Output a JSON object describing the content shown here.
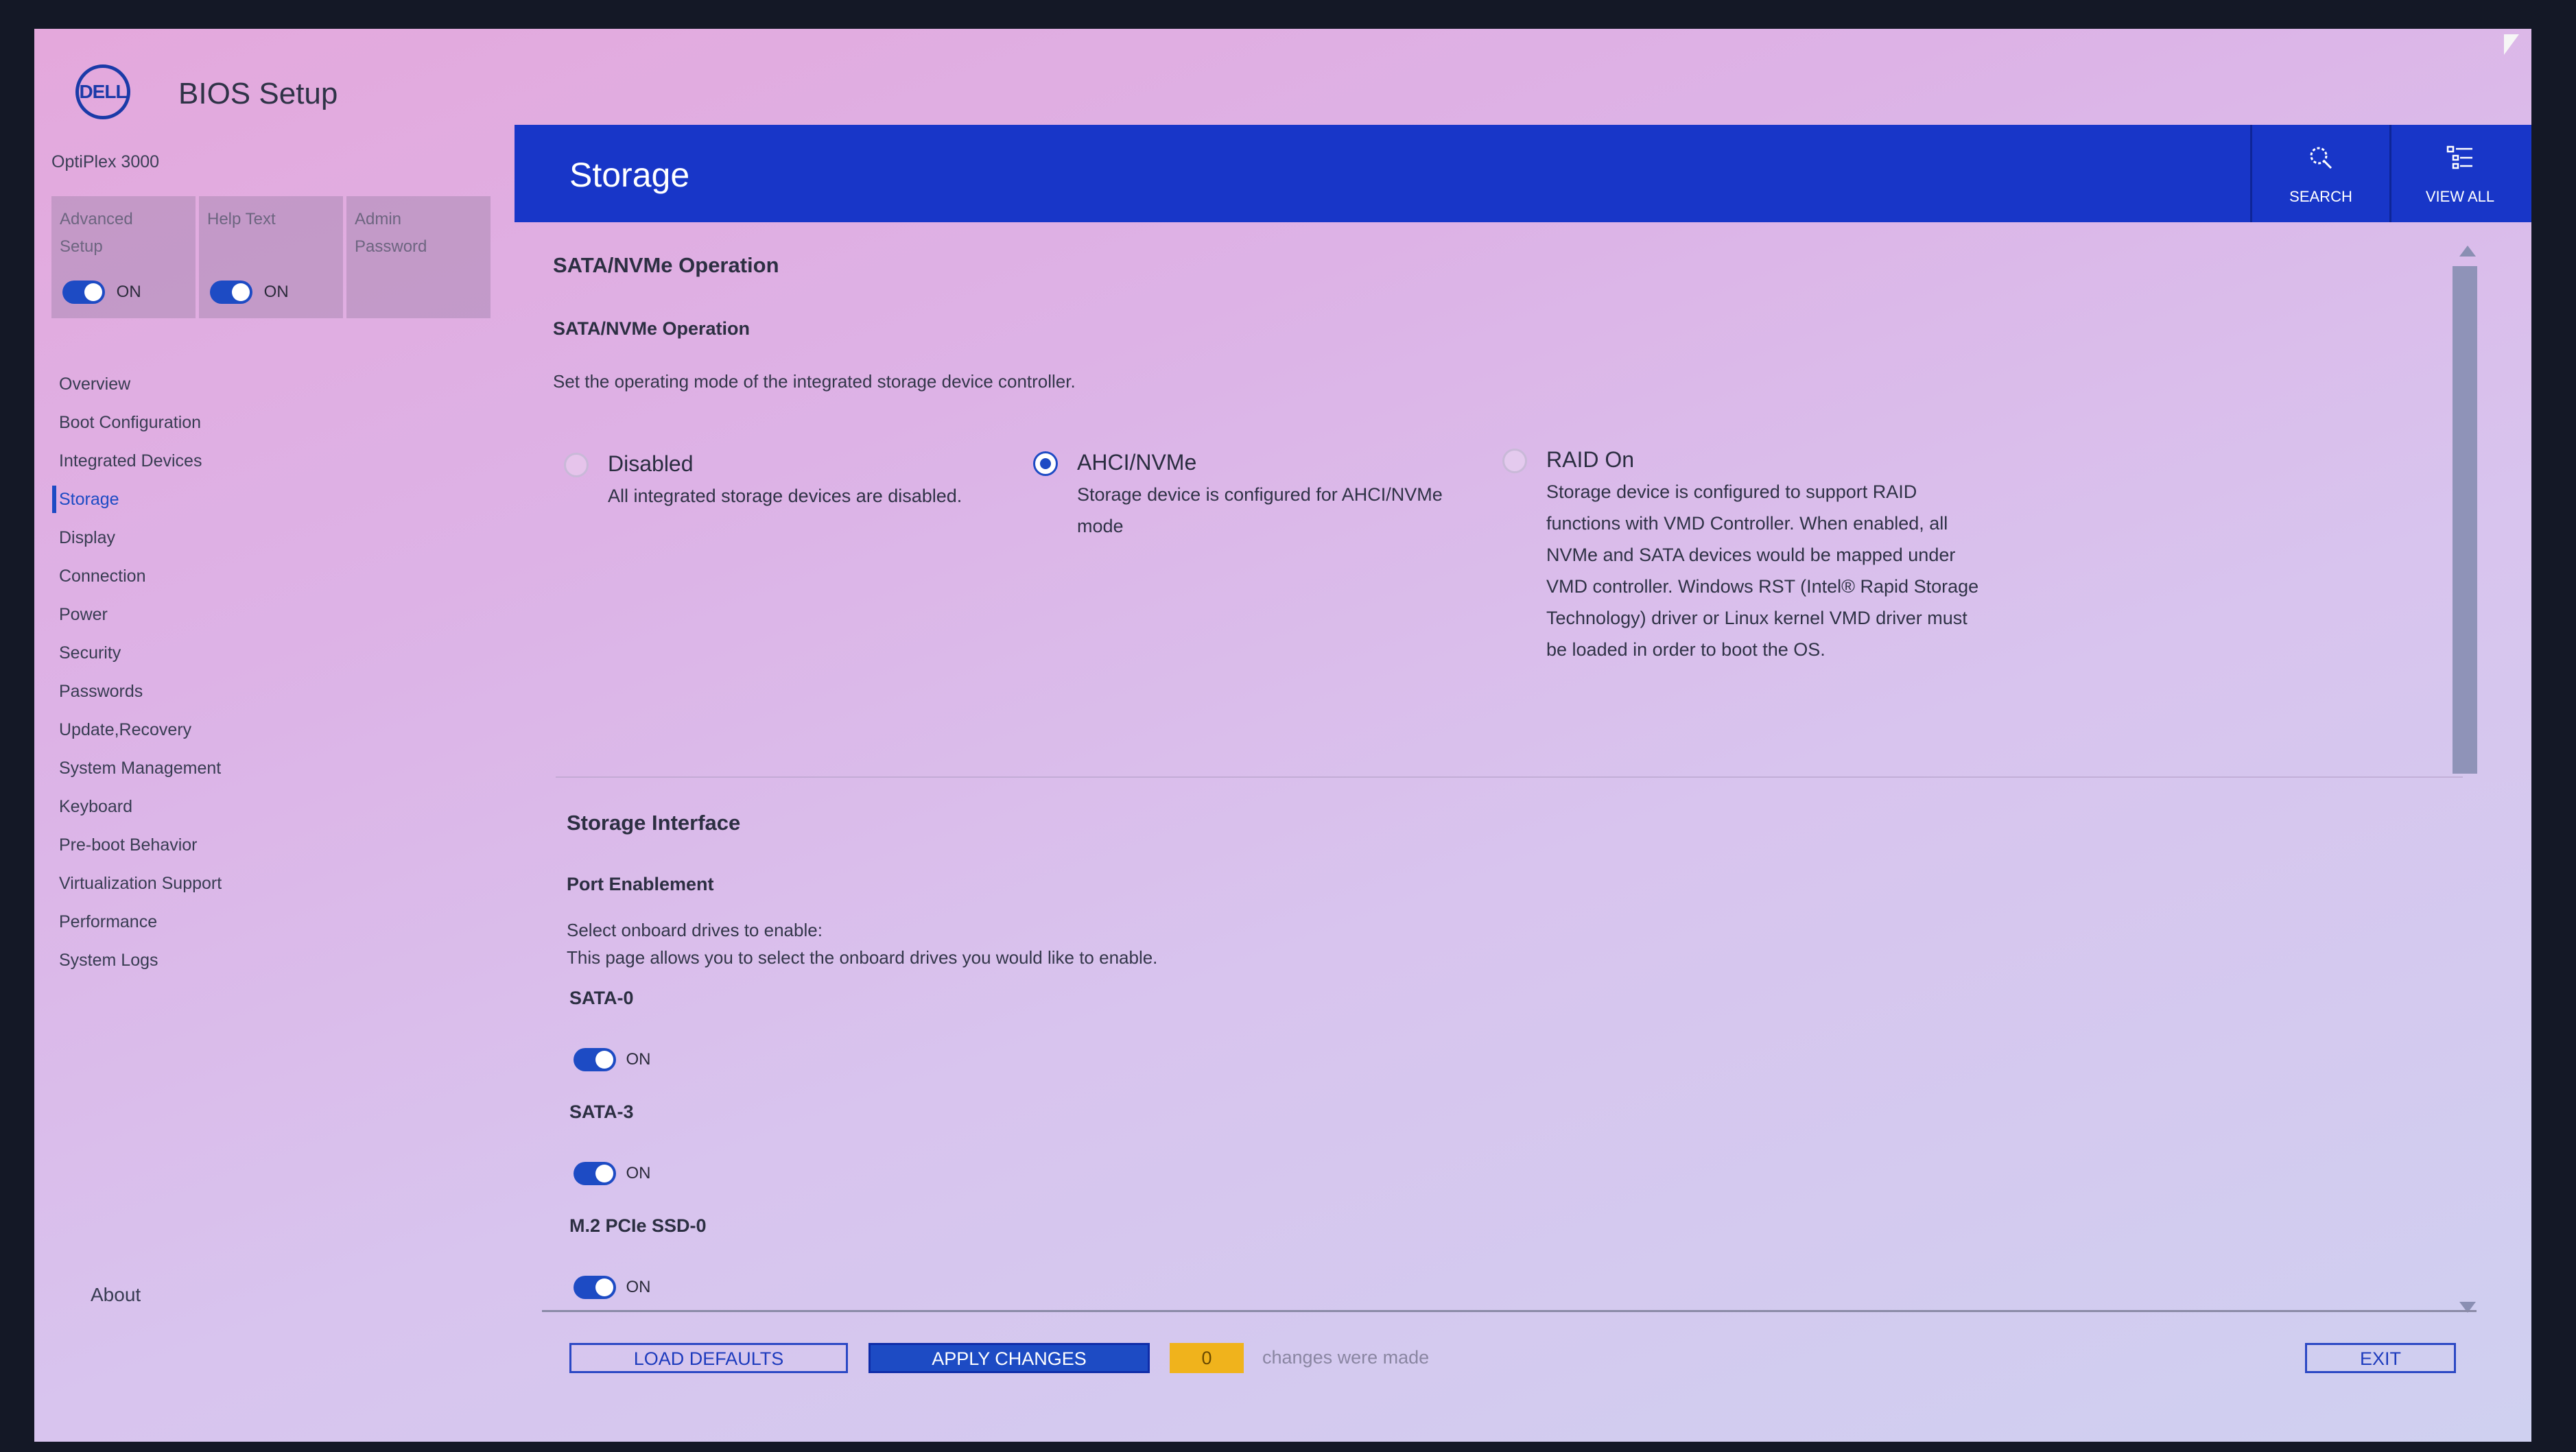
{
  "header": {
    "logo_text": "DELL",
    "app_title": "BIOS Setup",
    "model": "OptiPlex 3000"
  },
  "tiles": [
    {
      "label_line1": "Advanced",
      "label_line2": "Setup",
      "toggle_state": "ON"
    },
    {
      "label_line1": "Help Text",
      "label_line2": "",
      "toggle_state": "ON"
    },
    {
      "label_line1": "Admin",
      "label_line2": "Password"
    }
  ],
  "sidebar": {
    "items": [
      {
        "label": "Overview"
      },
      {
        "label": "Boot Configuration"
      },
      {
        "label": "Integrated Devices"
      },
      {
        "label": "Storage"
      },
      {
        "label": "Display"
      },
      {
        "label": "Connection"
      },
      {
        "label": "Power"
      },
      {
        "label": "Security"
      },
      {
        "label": "Passwords"
      },
      {
        "label": "Update,Recovery"
      },
      {
        "label": "System Management"
      },
      {
        "label": "Keyboard"
      },
      {
        "label": "Pre-boot Behavior"
      },
      {
        "label": "Virtualization Support"
      },
      {
        "label": "Performance"
      },
      {
        "label": "System Logs"
      }
    ],
    "active": "Storage",
    "about": "About"
  },
  "titlebar": {
    "title": "Storage",
    "search_label": "SEARCH",
    "viewall_label": "VIEW ALL"
  },
  "sata": {
    "section_title": "SATA/NVMe Operation",
    "sub_title": "SATA/NVMe Operation",
    "description": "Set the operating mode of the integrated storage device controller.",
    "options": [
      {
        "label": "Disabled",
        "desc": "All integrated storage devices are disabled.",
        "selected": false
      },
      {
        "label": "AHCI/NVMe",
        "desc": "Storage device is configured for AHCI/NVMe mode",
        "selected": true
      },
      {
        "label": "RAID On",
        "desc": "Storage device is configured to support RAID functions with VMD Controller. When enabled, all NVMe and SATA devices would be mapped under VMD controller. Windows RST (Intel® Rapid Storage Technology) driver or Linux kernel VMD driver must be loaded in order to boot the OS.",
        "selected": false
      }
    ]
  },
  "storage_interface": {
    "section_title": "Storage Interface",
    "sub_title": "Port Enablement",
    "desc_line1": "Select onboard drives to enable:",
    "desc_line2": "This page allows you to select the onboard drives you would like to enable.",
    "ports": [
      {
        "name": "SATA-0",
        "state": "ON"
      },
      {
        "name": "SATA-3",
        "state": "ON"
      },
      {
        "name": "M.2 PCIe SSD-0",
        "state": "ON"
      }
    ]
  },
  "footer": {
    "load_defaults": "LOAD DEFAULTS",
    "apply_changes": "APPLY CHANGES",
    "change_count": "0",
    "changes_text": "changes were made",
    "exit": "EXIT"
  },
  "colors": {
    "accent": "#1D4BC4",
    "titlebar": "#1836C8",
    "counter": "#F0B31C"
  }
}
